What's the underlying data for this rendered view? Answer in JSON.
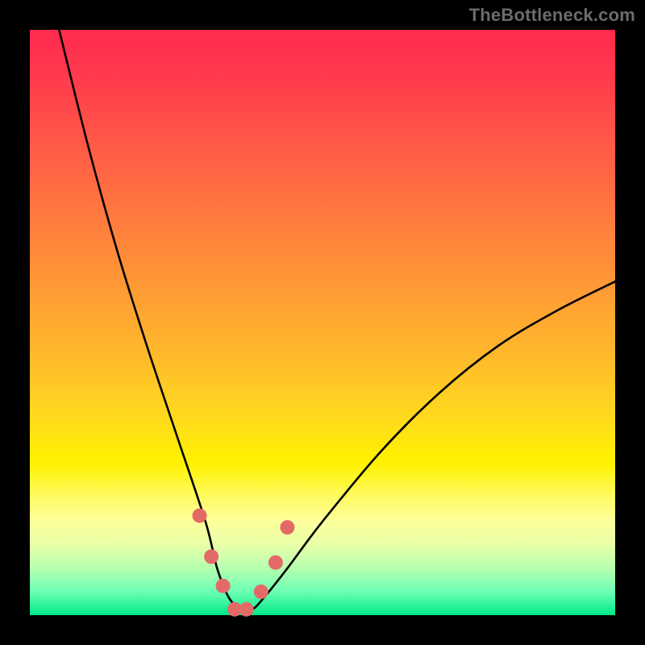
{
  "watermark": "TheBottleneck.com",
  "chart_data": {
    "type": "line",
    "title": "",
    "xlabel": "",
    "ylabel": "",
    "xlim": [
      0,
      100
    ],
    "ylim": [
      0,
      100
    ],
    "series": [
      {
        "name": "bottleneck-curve",
        "x": [
          5,
          10,
          15,
          20,
          25,
          30,
          32,
          34,
          36,
          38,
          40,
          44,
          50,
          60,
          70,
          80,
          90,
          100
        ],
        "values": [
          100,
          80,
          62,
          46,
          31,
          16,
          8,
          3,
          1,
          1,
          3,
          8,
          16,
          28,
          38,
          46,
          52,
          57
        ]
      }
    ],
    "markers": {
      "name": "highlight-points",
      "x": [
        29,
        31,
        33,
        35,
        37,
        39.5,
        42,
        44
      ],
      "values": [
        17,
        10,
        5,
        1,
        1,
        4,
        9,
        15
      ]
    }
  },
  "colors": {
    "curve": "#000000",
    "marker": "#e46a68"
  }
}
